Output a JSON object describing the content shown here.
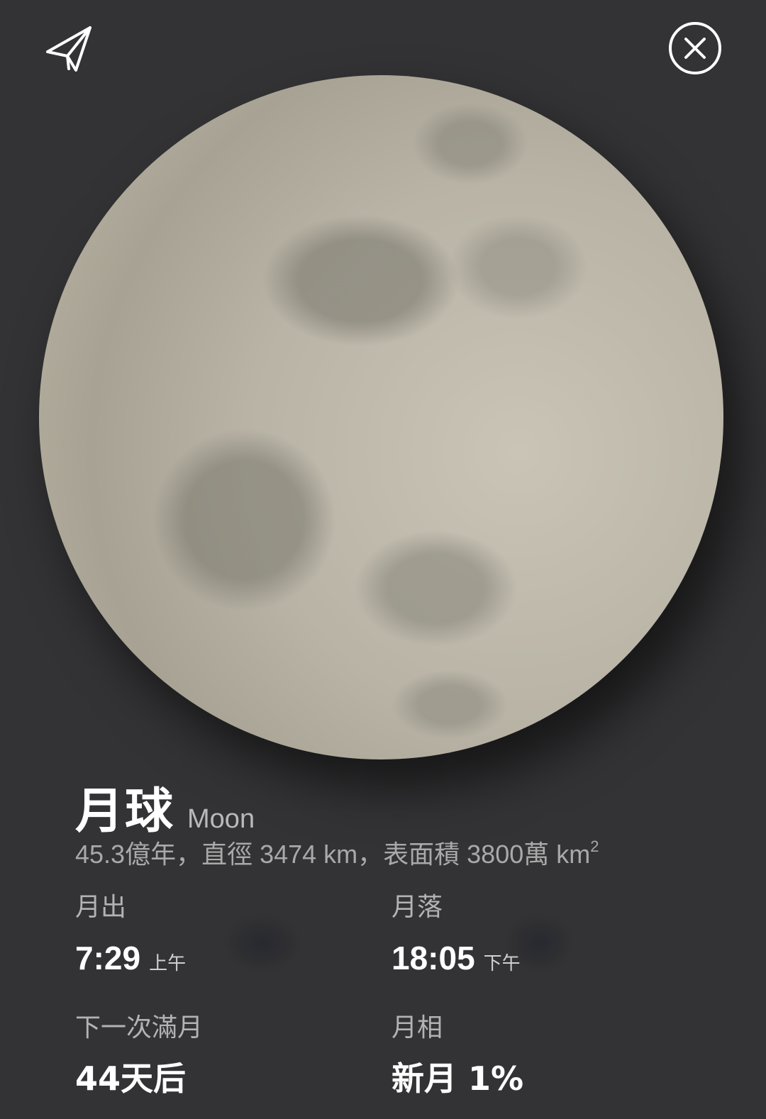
{
  "header": {
    "share_icon": "paper-plane-icon",
    "close_icon": "close-icon"
  },
  "body": {
    "title_zh": "月球",
    "title_en": "Moon",
    "subtitle_text": "45.3億年，直徑 3474 km，表面積 3800萬 km",
    "subtitle_sup": "2"
  },
  "stats": {
    "moonrise": {
      "label": "月出",
      "value": "7:29",
      "suffix": "上午"
    },
    "moonset": {
      "label": "月落",
      "value": "18:05",
      "suffix": "下午"
    },
    "next_full_moon": {
      "label": "下一次滿月",
      "value": "44天后"
    },
    "phase": {
      "label": "月相",
      "value": "新月 1%"
    }
  },
  "colors": {
    "background": "#333234",
    "moon": "#c4bfb1",
    "text_primary": "#ffffff",
    "text_secondary": "#b3b3b3"
  }
}
